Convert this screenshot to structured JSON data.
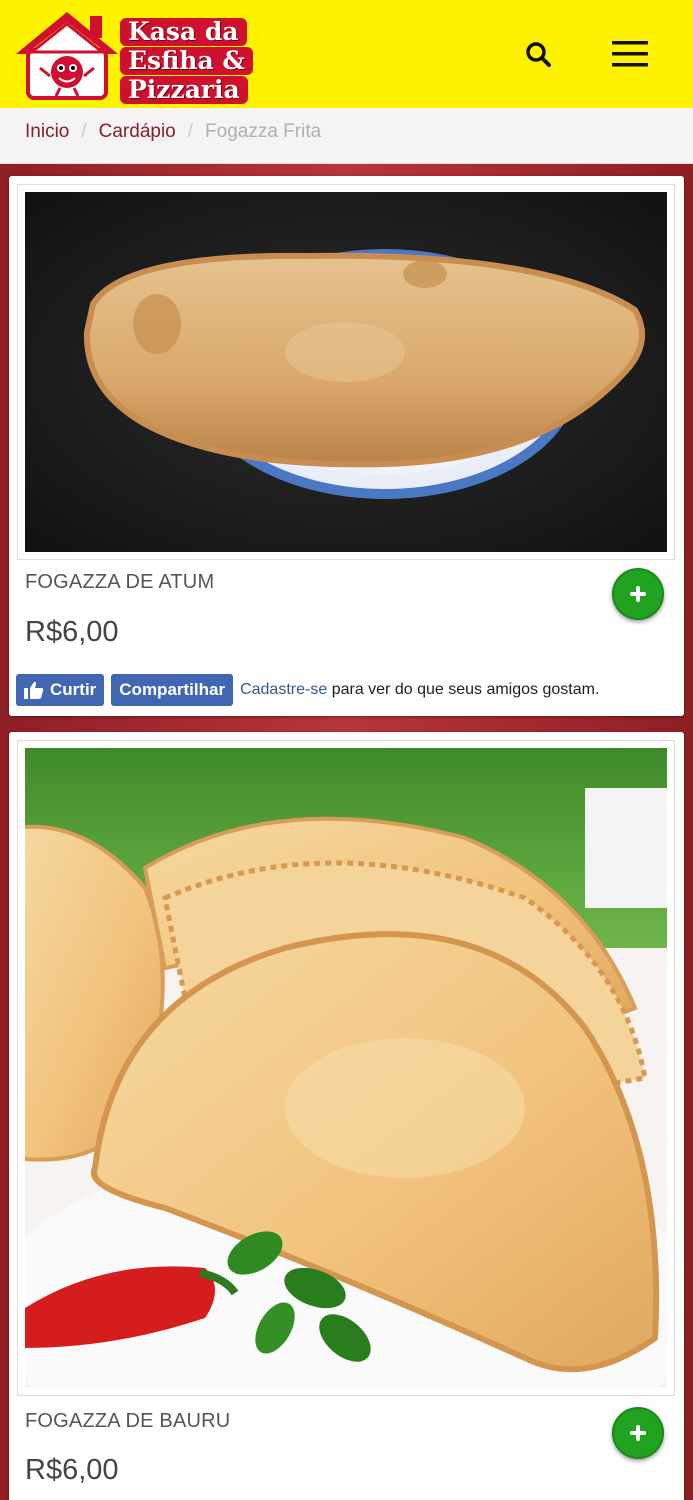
{
  "header": {
    "logo_lines": [
      "Kasa da",
      "Esfiha &",
      "Pizzaria"
    ],
    "colors": {
      "background": "#fff200",
      "logo_red": "#d0102f"
    }
  },
  "breadcrumb": {
    "items": [
      "Inicio",
      "Cardápio"
    ],
    "separator": "/",
    "current": "Fogazza Frita"
  },
  "products": [
    {
      "name": "FOGAZZA DE ATUM",
      "price": "R$6,00",
      "image": "fogazza-atum-photo"
    },
    {
      "name": "FOGAZZA DE BAURU",
      "price": "R$6,00",
      "image": "fogazza-bauru-photo"
    }
  ],
  "facebook": {
    "like_label": "Curtir",
    "share_label": "Compartilhar",
    "signup_link": "Cadastre-se",
    "signup_text": "para ver do que seus amigos gostam."
  },
  "icons": [
    "house-logo-icon",
    "search-icon",
    "hamburger-menu-icon",
    "plus-icon",
    "thumbs-up-icon"
  ],
  "colors": {
    "add_button": "#21a321",
    "facebook_blue": "#4267b2",
    "link": "#8b1d2c"
  }
}
